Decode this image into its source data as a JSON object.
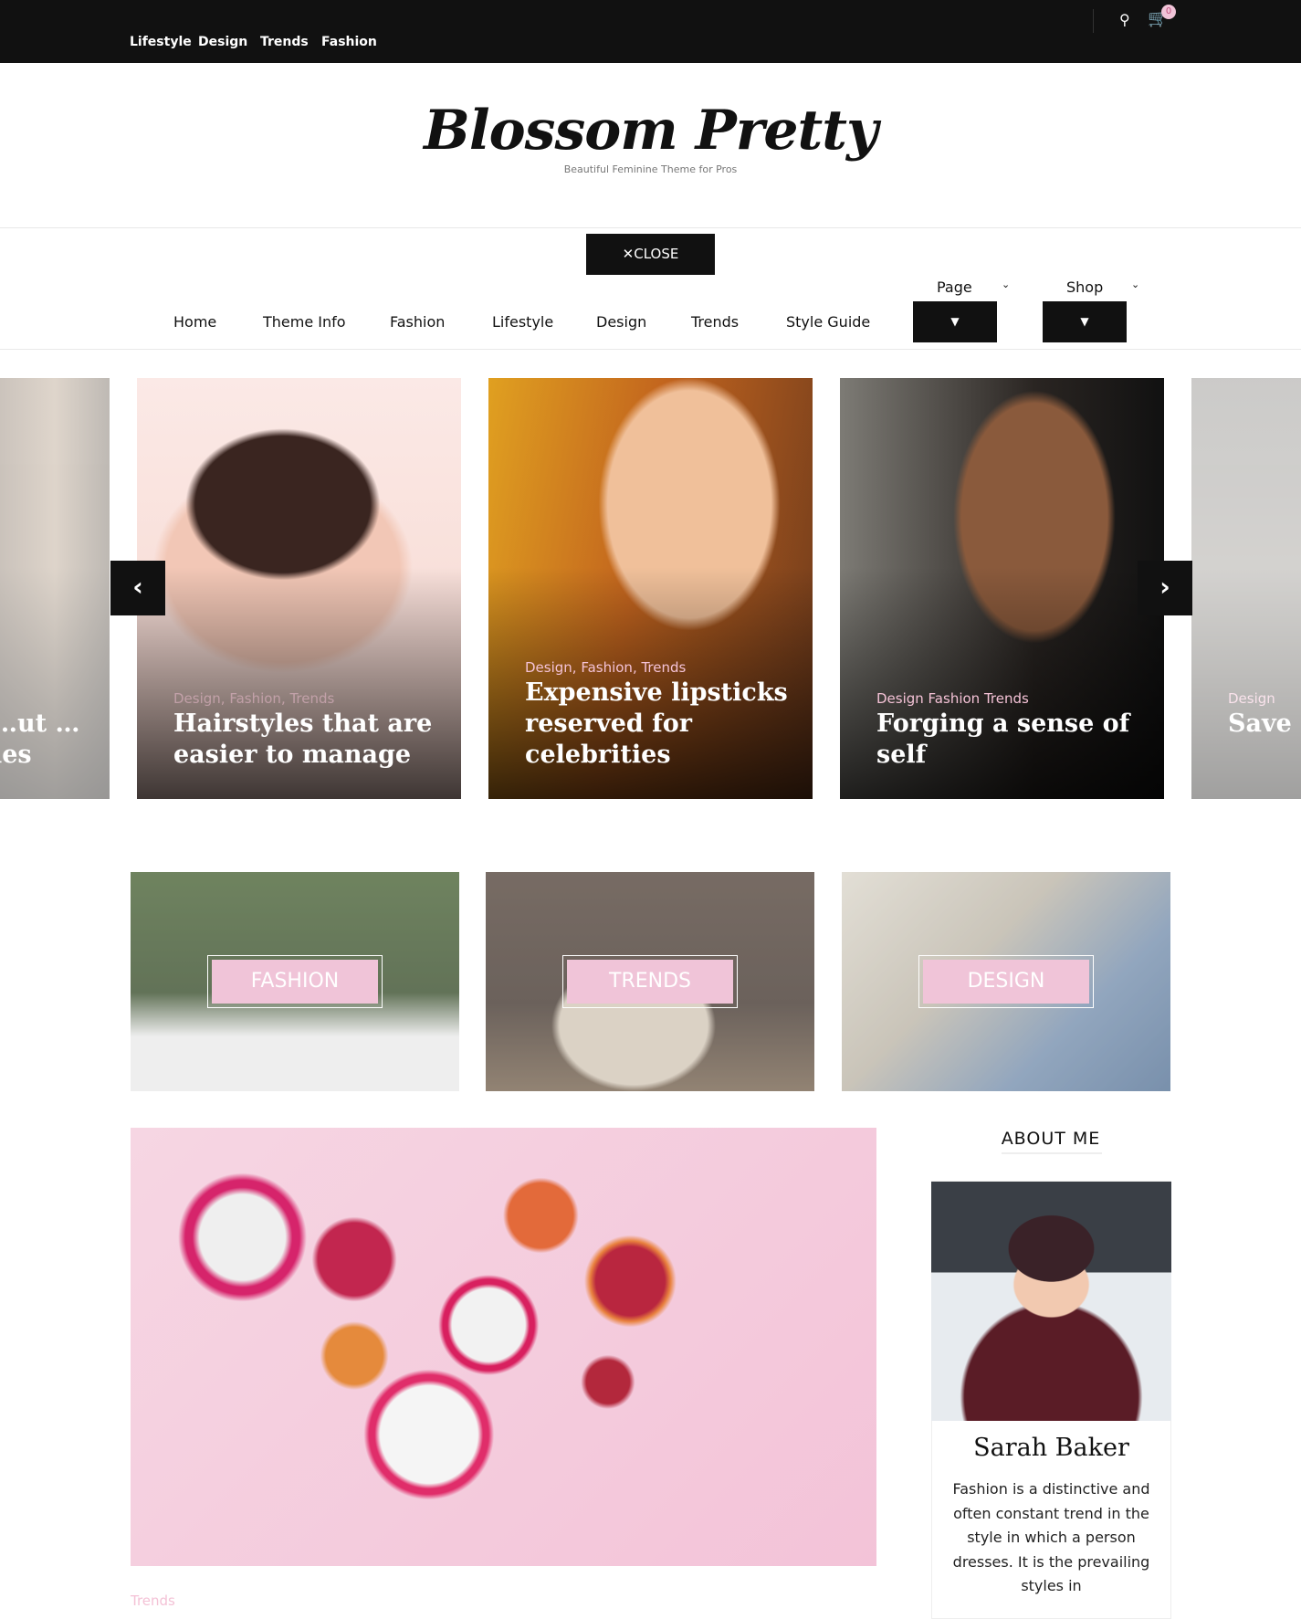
{
  "topbar": {
    "links": [
      "Lifestyle",
      "Design",
      "Trends",
      "Fashion"
    ],
    "cart_count": "0",
    "icons": [
      "search-icon",
      "cart-icon"
    ]
  },
  "header": {
    "title": "Blossom Pretty",
    "tagline": "Beautiful Feminine Theme for Pros"
  },
  "menu": {
    "close_label": "✕CLOSE",
    "items": [
      "Home",
      "Theme Info",
      "Fashion",
      "Lifestyle",
      "Design",
      "Trends",
      "Style Guide"
    ],
    "dropdowns": [
      "Page",
      "Shop"
    ]
  },
  "slider": {
    "slides": [
      {
        "cats": "",
        "title": "…ut …les"
      },
      {
        "cats": "Design, Fashion, Trends",
        "title": "Hairstyles that are easier to manage"
      },
      {
        "cats": "Design, Fashion, Trends",
        "title": "Expensive lipsticks reserved for celebrities"
      },
      {
        "cats": "Design Fashion Trends",
        "title": "Forging a sense of self"
      },
      {
        "cats": "Design",
        "title": "Save lo… Trend…"
      }
    ],
    "prev_icon": "chevron-left-icon",
    "next_icon": "chevron-right-icon"
  },
  "categories": [
    "FASHION",
    "TRENDS",
    "DESIGN"
  ],
  "featured": {
    "category": "Trends"
  },
  "about": {
    "heading": "ABOUT ME",
    "name": "Sarah Baker",
    "text": "Fashion is a distinctive and often constant trend in the style in which a person dresses. It is the prevailing styles in"
  },
  "colors": {
    "accent": "#f0c4d8",
    "dark": "#111111"
  }
}
